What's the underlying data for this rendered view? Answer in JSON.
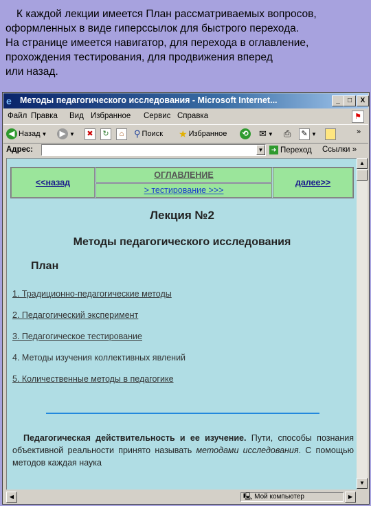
{
  "caption": {
    "lines": [
      "К каждой лекции имеется План рассматриваемых вопросов,",
      "оформленных в виде гиперссылок для быстрого перехода.",
      "На странице имеется навигатор, для перехода в оглавление,",
      "прохождения тестирования, для продвижения вперед",
      "или назад."
    ]
  },
  "window": {
    "title": "Методы педагогического исследования - Microsoft Internet...",
    "btn_minimize": "_",
    "btn_maximize": "□",
    "btn_close": "X"
  },
  "menubar": [
    "Файл",
    "Правка",
    "Вид",
    "Избранное",
    "Сервис",
    "Справка"
  ],
  "toolbar": {
    "back_label": "Назад",
    "search_label": "Поиск",
    "favorites_label": "Избранное",
    "more": "»"
  },
  "addressbar": {
    "label": "Адрес:",
    "value": "",
    "go_label": "Переход",
    "links_label": "Ссылки",
    "more": "»"
  },
  "page": {
    "nav": {
      "back": "<<назад",
      "contents": "ОГЛАВЛЕНИЕ",
      "testing": "> тестирование >>>",
      "next": "далее>>"
    },
    "lecture_title": "Лекция №2",
    "lecture_subtitle": "Методы педагогического исследования",
    "plan_heading": "План",
    "plan_items": [
      "1. Традиционно-педагогические методы",
      "2. Педагогический эксперимент",
      "3. Педагогическое тестирование",
      "4. Методы изучения коллективных явлений",
      "5. Количественные методы в педагогике"
    ],
    "paragraph": {
      "bold": "Педагогическая действительность и ее изучение.",
      "text1": " Пути, способы познания объективной реальности принято называть ",
      "italic": "методами исследования",
      "text2": ". С помощью методов каждая наука"
    }
  },
  "statusbar": {
    "zone": "Мой компьютер"
  }
}
